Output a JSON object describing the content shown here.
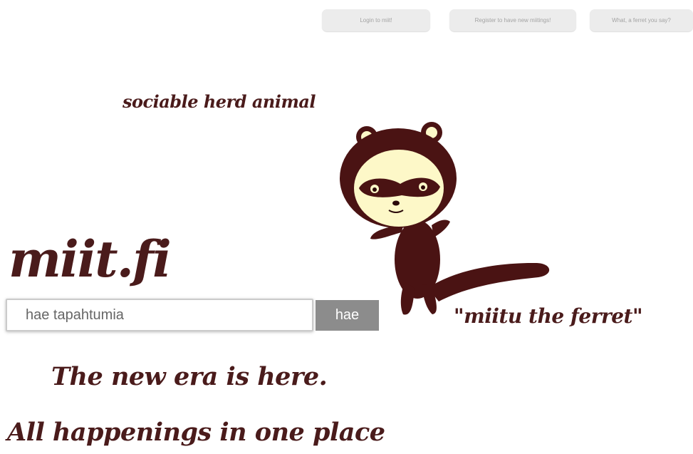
{
  "nav": {
    "login_label": "Login to miit!",
    "register_label": "Register to have new miitings!",
    "ferret_label": "What, a ferret you say?"
  },
  "hero": {
    "tagline": "sociable herd animal",
    "logo": "miit.fi",
    "ferret_caption": "\"miitu the ferret\"",
    "headline_1": "The new era is here.",
    "headline_2": "All happenings in one place"
  },
  "search": {
    "placeholder": "hae tapahtumia",
    "button_label": "hae"
  },
  "colors": {
    "brand": "#4a1b1b",
    "ferret_face": "#fdf8c8",
    "button_gray": "#8c8c8c",
    "nav_gray": "#ececec"
  }
}
